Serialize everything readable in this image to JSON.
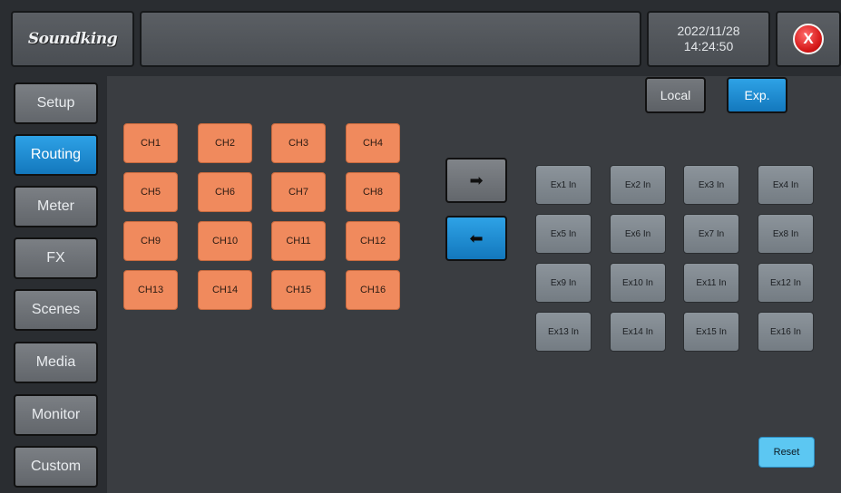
{
  "header": {
    "logo": "Soundking",
    "date": "2022/11/28",
    "time": "14:24:50",
    "close_label": "X"
  },
  "sidebar": {
    "items": [
      {
        "label": "Setup",
        "active": false
      },
      {
        "label": "Routing",
        "active": true
      },
      {
        "label": "Meter",
        "active": false
      },
      {
        "label": "FX",
        "active": false
      },
      {
        "label": "Scenes",
        "active": false
      },
      {
        "label": "Media",
        "active": false
      },
      {
        "label": "Monitor",
        "active": false
      },
      {
        "label": "Custom",
        "active": false
      }
    ]
  },
  "routing": {
    "mode_local": "Local",
    "mode_exp": "Exp.",
    "selected_mode": "Exp.",
    "channels": [
      "CH1",
      "CH2",
      "CH3",
      "CH4",
      "CH5",
      "CH6",
      "CH7",
      "CH8",
      "CH9",
      "CH10",
      "CH11",
      "CH12",
      "CH13",
      "CH14",
      "CH15",
      "CH16"
    ],
    "ex_inputs": [
      "Ex1 In",
      "Ex2 In",
      "Ex3 In",
      "Ex4 In",
      "Ex5 In",
      "Ex6 In",
      "Ex7 In",
      "Ex8 In",
      "Ex9 In",
      "Ex10 In",
      "Ex11 In",
      "Ex12 In",
      "Ex13 In",
      "Ex14 In",
      "Ex15 In",
      "Ex16 In"
    ],
    "arrow_right": "➡",
    "arrow_left": "⬅",
    "reset_label": "Reset"
  },
  "colors": {
    "accent_blue": "#1f8fd6",
    "channel_orange": "#f08a5d",
    "reset_blue": "#5cc7f2",
    "close_red": "#d81d1d"
  }
}
